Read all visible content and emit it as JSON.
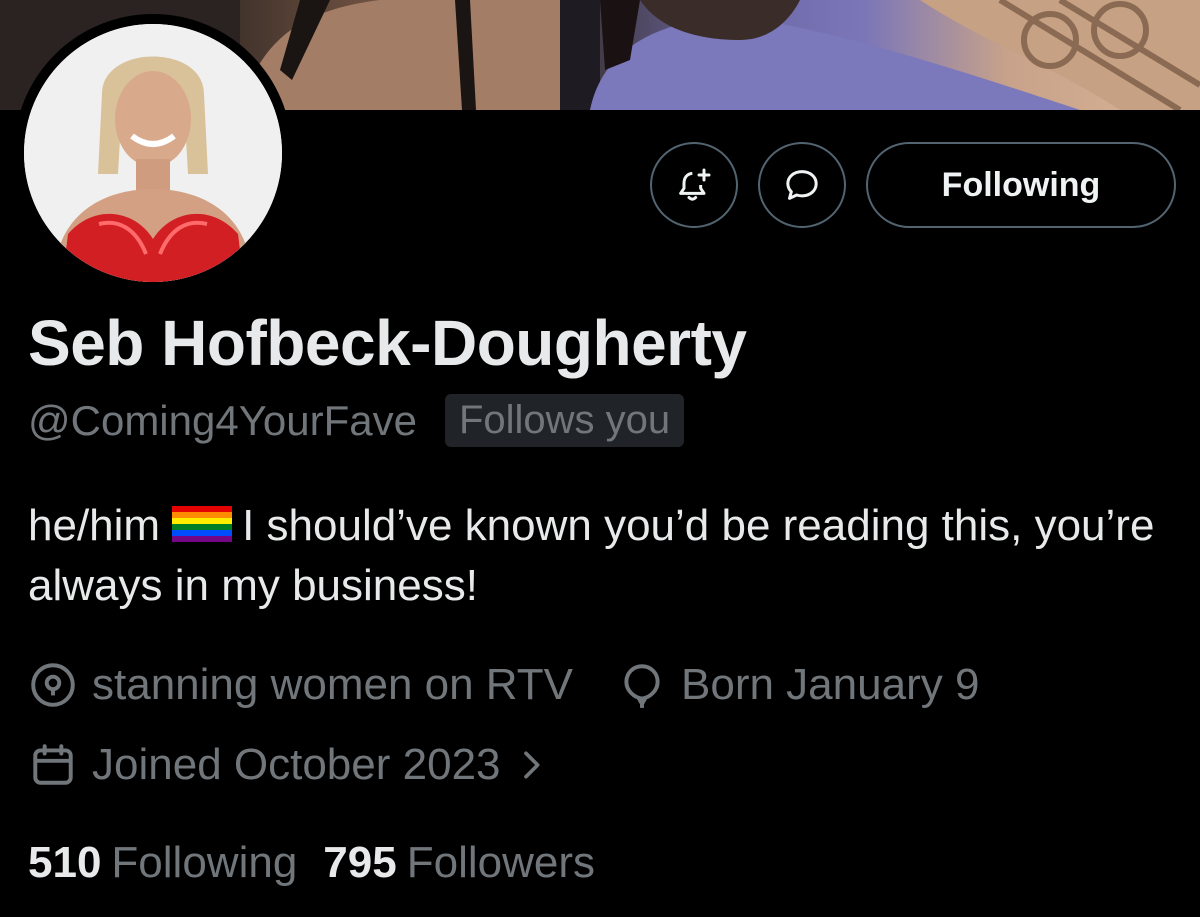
{
  "header": {
    "follow_button_label": "Following"
  },
  "profile": {
    "display_name": "Seb Hofbeck-Dougherty",
    "handle": "@Coming4YourFave",
    "follows_you_badge": "Follows you",
    "bio_start": "he/him",
    "bio_end": "I should’ve known you’d be reading this, you’re always in my business!",
    "location": "stanning women on RTV",
    "birthday": "Born January 9",
    "joined": "Joined October 2023",
    "following_count": "510",
    "following_label": "Following",
    "followers_count": "795",
    "followers_label": "Followers"
  },
  "icons": {
    "notify": "bell-plus-icon",
    "message": "chat-bubble-icon",
    "location": "location-pin-icon",
    "birthday": "balloon-icon",
    "joined": "calendar-icon",
    "chevron": "chevron-right-icon",
    "flag": "rainbow-flag-icon"
  },
  "colors": {
    "background": "#000000",
    "text_primary": "#e7e9ea",
    "text_secondary": "#71767b",
    "button_border": "#536471",
    "badge_bg": "#202327"
  }
}
